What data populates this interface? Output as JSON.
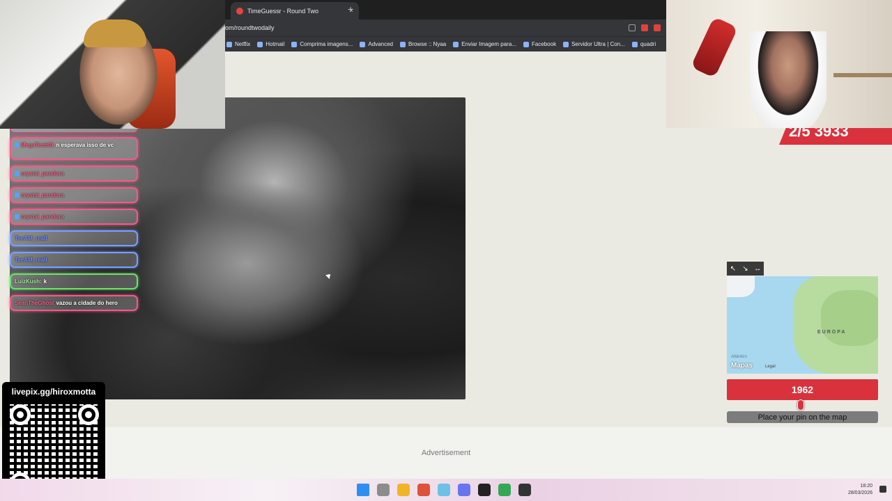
{
  "browser": {
    "tab_title": "TimeGuessr - Round Two",
    "tab_close": "×",
    "new_tab": "+",
    "url": "om/roundtwodaily",
    "bookmarks": [
      "Netflix",
      "Hotmail",
      "Comprima imagens...",
      "Advanced",
      "Browse :: Nyaa",
      "Enviar Imagem para...",
      "Facebook",
      "Servidor Ultra | Con...",
      "quadri"
    ]
  },
  "game": {
    "score_banner": "2/5 3933",
    "map": {
      "region_label": "EUROPA",
      "ocean_label": "Atlântico",
      "logo": "Mapas",
      "legal": "Legal",
      "controls": [
        "↖",
        "↘",
        "↔"
      ]
    },
    "year": "1962",
    "year_fraction": 0.49,
    "place_pin_label": "Place your pin on the map",
    "advertisement": "Advertisement"
  },
  "chat": {
    "messages": [
      {
        "user": "MegaTech01",
        "text": "n esperava isso de vc",
        "style": "pink"
      },
      {
        "user": "crystal_pandora",
        "text": "",
        "style": "pink"
      },
      {
        "user": "crystal_pandora",
        "text": "",
        "style": "pink"
      },
      {
        "user": "crystal_pandora",
        "text": "",
        "style": "pink"
      },
      {
        "user": "TeeAM_reall",
        "text": "",
        "style": "blue"
      },
      {
        "user": "TeeAM_reall",
        "text": "",
        "style": "blue"
      },
      {
        "user": "LuizKush:",
        "text": "k",
        "style": "green"
      },
      {
        "user": "SeanTheGhost",
        "text": "vazou a cidade do hero",
        "style": "pink"
      }
    ]
  },
  "overlay": {
    "qr_title": "livepix.gg/hiroxmotta"
  },
  "taskbar": {
    "time": "18:20",
    "date": "28/03/2026",
    "icon_colors": [
      "#2f8ff0",
      "#8c8c8c",
      "#f0b429",
      "#e0513b",
      "#6bc1e6",
      "#6875f0",
      "#222222",
      "#34a853",
      "#333333"
    ]
  }
}
